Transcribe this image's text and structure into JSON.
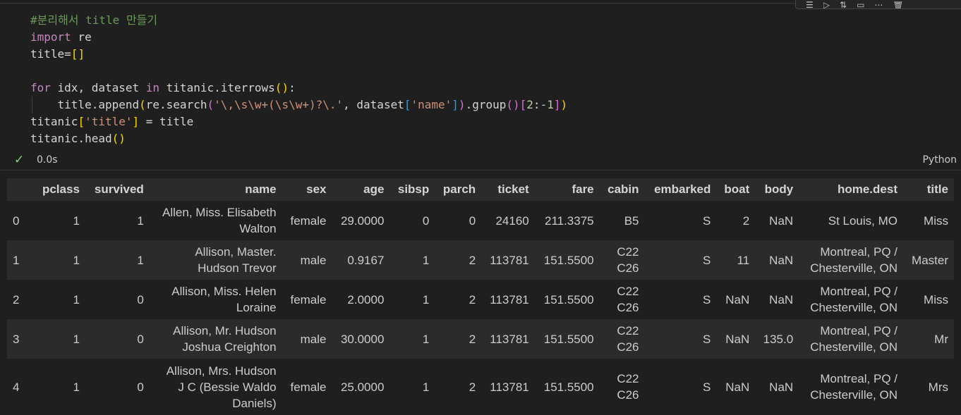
{
  "toolbar": {
    "icons": [
      "run-by-line-icon",
      "execute-above-icon",
      "execute-below-icon",
      "split-cell-icon",
      "more-icon",
      "delete-icon"
    ]
  },
  "code": {
    "comment": "#분리해서 title 만들기",
    "import_kw": "import",
    "import_mod": " re",
    "l3_id": "title=",
    "l3_open": "[",
    "l3_close": "]",
    "for_kw": "for",
    "for_vars": " idx, dataset ",
    "in_kw": "in",
    "for_obj": " titanic.iterrows",
    "for_paren_open": "(",
    "for_paren_close": ")",
    "for_colon": ":",
    "append_call": "    title.append",
    "ap_open": "(",
    "re_search": "re.search",
    "rs_open": "(",
    "pattern": "'\\,\\s\\w+(\\s\\w+)?\\.'",
    "comma_ds": ", dataset",
    "idx_open": "[",
    "name_str": "'name'",
    "idx_close": "]",
    "rs_close": ")",
    "group_call": ".group",
    "grp_open": "(",
    "grp_close": ")",
    "sl_open": "[",
    "sl_start": "2",
    "sl_colon": ":",
    "sl_end": "-1",
    "sl_close": "]",
    "ap_close": ")",
    "assign_obj": "titanic",
    "as_open": "[",
    "as_key": "'title'",
    "as_close": "]",
    "assign_rest": " = title",
    "head_call": "titanic.head",
    "head_open": "(",
    "head_close": ")"
  },
  "status": {
    "check": "✓",
    "time": "0.0s",
    "language": "Python"
  },
  "table": {
    "columns": [
      "",
      "pclass",
      "survived",
      "name",
      "sex",
      "age",
      "sibsp",
      "parch",
      "ticket",
      "fare",
      "cabin",
      "embarked",
      "boat",
      "body",
      "home.dest",
      "title"
    ],
    "rows": [
      {
        "index": "0",
        "pclass": "1",
        "survived": "1",
        "name": [
          "Allen, Miss. Elisabeth",
          "Walton"
        ],
        "sex": "female",
        "age": "29.0000",
        "sibsp": "0",
        "parch": "0",
        "ticket": "24160",
        "fare": "211.3375",
        "cabin": [
          "B5"
        ],
        "embarked": "S",
        "boat": "2",
        "body": "NaN",
        "home_dest": [
          "St Louis, MO"
        ],
        "title": "Miss"
      },
      {
        "index": "1",
        "pclass": "1",
        "survived": "1",
        "name": [
          "Allison, Master.",
          "Hudson Trevor"
        ],
        "sex": "male",
        "age": "0.9167",
        "sibsp": "1",
        "parch": "2",
        "ticket": "113781",
        "fare": "151.5500",
        "cabin": [
          "C22",
          "C26"
        ],
        "embarked": "S",
        "boat": "11",
        "body": "NaN",
        "home_dest": [
          "Montreal, PQ /",
          "Chesterville, ON"
        ],
        "title": "Master"
      },
      {
        "index": "2",
        "pclass": "1",
        "survived": "0",
        "name": [
          "Allison, Miss. Helen",
          "Loraine"
        ],
        "sex": "female",
        "age": "2.0000",
        "sibsp": "1",
        "parch": "2",
        "ticket": "113781",
        "fare": "151.5500",
        "cabin": [
          "C22",
          "C26"
        ],
        "embarked": "S",
        "boat": "NaN",
        "body": "NaN",
        "home_dest": [
          "Montreal, PQ /",
          "Chesterville, ON"
        ],
        "title": "Miss"
      },
      {
        "index": "3",
        "pclass": "1",
        "survived": "0",
        "name": [
          "Allison, Mr. Hudson",
          "Joshua Creighton"
        ],
        "sex": "male",
        "age": "30.0000",
        "sibsp": "1",
        "parch": "2",
        "ticket": "113781",
        "fare": "151.5500",
        "cabin": [
          "C22",
          "C26"
        ],
        "embarked": "S",
        "boat": "NaN",
        "body": "135.0",
        "home_dest": [
          "Montreal, PQ /",
          "Chesterville, ON"
        ],
        "title": "Mr"
      },
      {
        "index": "4",
        "pclass": "1",
        "survived": "0",
        "name": [
          "Allison, Mrs. Hudson",
          "J C (Bessie Waldo",
          "Daniels)"
        ],
        "sex": "female",
        "age": "25.0000",
        "sibsp": "1",
        "parch": "2",
        "ticket": "113781",
        "fare": "151.5500",
        "cabin": [
          "C22",
          "C26"
        ],
        "embarked": "S",
        "boat": "NaN",
        "body": "NaN",
        "home_dest": [
          "Montreal, PQ /",
          "Chesterville, ON"
        ],
        "title": "Mrs"
      }
    ]
  }
}
